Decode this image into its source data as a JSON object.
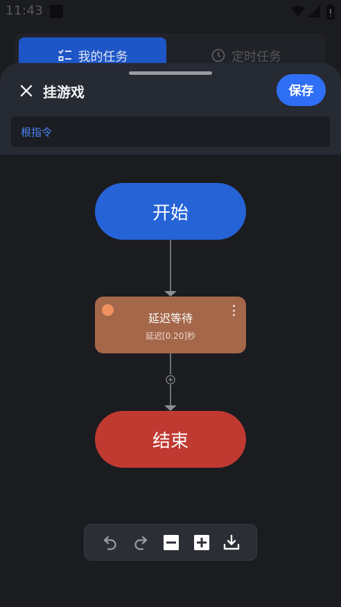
{
  "status_bar": {
    "time": "11:43"
  },
  "tabs": [
    {
      "label": "我的任务",
      "active": true
    },
    {
      "label": "定时任务",
      "active": false
    }
  ],
  "editor": {
    "title": "挂游戏",
    "save_label": "保存",
    "breadcrumb": "根指令"
  },
  "flow": {
    "start_label": "开始",
    "delay_node": {
      "title": "延迟等待",
      "subtitle": "延迟[0.20]秒"
    },
    "end_label": "结束"
  },
  "toolbar": {
    "buttons": [
      "undo-icon",
      "redo-icon",
      "zoom-out-icon",
      "zoom-in-icon",
      "download-icon"
    ]
  },
  "colors": {
    "background": "#1b1c20",
    "sheet": "#262a33",
    "accent": "#2f6ff5",
    "start_node": "#2563d6",
    "delay_node": "#a4674a",
    "end_node": "#c03a32"
  }
}
